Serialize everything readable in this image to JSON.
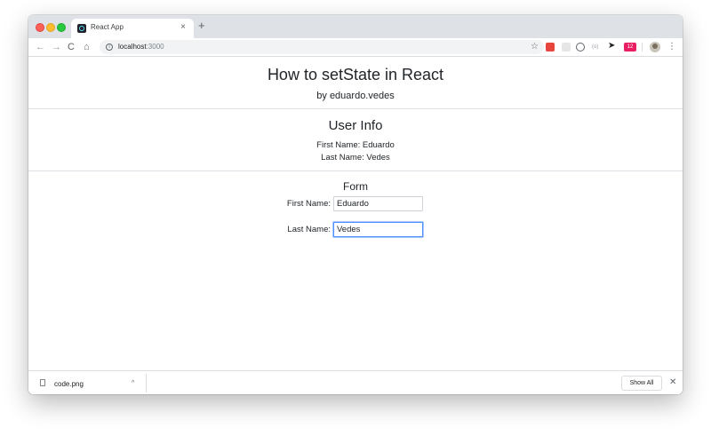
{
  "browser": {
    "tab_title": "React App",
    "tab_close": "×",
    "new_tab": "+",
    "nav": {
      "back": "←",
      "forward": "→",
      "reload": "C",
      "home": "⌂"
    },
    "url_host": "localhost",
    "url_port": ":3000",
    "info_glyph": "i",
    "star": "☆",
    "ext_badge": "12",
    "ext_pin": "(o)",
    "menu": "⋮"
  },
  "page": {
    "title": "How to setState in React",
    "subtitle": "by eduardo.vedes",
    "user_info": {
      "heading": "User Info",
      "first_name_line": "First Name: Eduardo",
      "last_name_line": "Last Name: Vedes"
    },
    "form": {
      "heading": "Form",
      "first_label": "First Name:",
      "first_value": "Eduardo",
      "last_label": "Last Name:",
      "last_value": "Vedes"
    }
  },
  "downloads": {
    "file_name": "code.png",
    "chevron": "^",
    "show_all": "Show All",
    "close": "✕"
  },
  "colors": {
    "tab_strip": "#dee1e6",
    "focus_ring": "#4d90fe",
    "text": "#212529"
  }
}
